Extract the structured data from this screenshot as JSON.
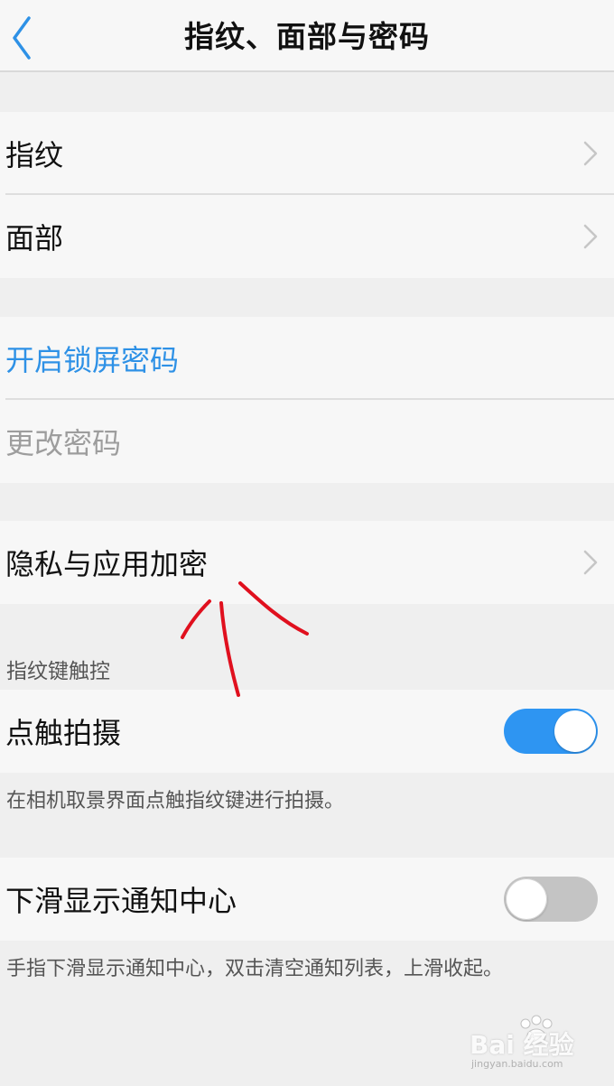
{
  "header": {
    "title": "指纹、面部与密码"
  },
  "biometrics": {
    "fingerprint_label": "指纹",
    "face_label": "面部"
  },
  "password": {
    "enable_label": "开启锁屏密码",
    "change_label": "更改密码"
  },
  "privacy": {
    "label": "隐私与应用加密"
  },
  "fingerprint_key": {
    "section_title": "指纹键触控",
    "tap_capture_label": "点触拍摄",
    "tap_capture_on": true,
    "tap_capture_note": "在相机取景界面点触指纹键进行拍摄。"
  },
  "notification": {
    "label": "下滑显示通知中心",
    "on": false,
    "note": "手指下滑显示通知中心，双击清空通知列表，上滑收起。"
  },
  "watermark": {
    "brand": "Bai 经验",
    "domain": "jingyan.baidu.com"
  },
  "colors": {
    "accent": "#2e95f2",
    "link_blue": "#2e91e6",
    "annotation_red": "#e0101e"
  },
  "icons": [
    "back-chevron-icon",
    "chevron-right-icon"
  ]
}
